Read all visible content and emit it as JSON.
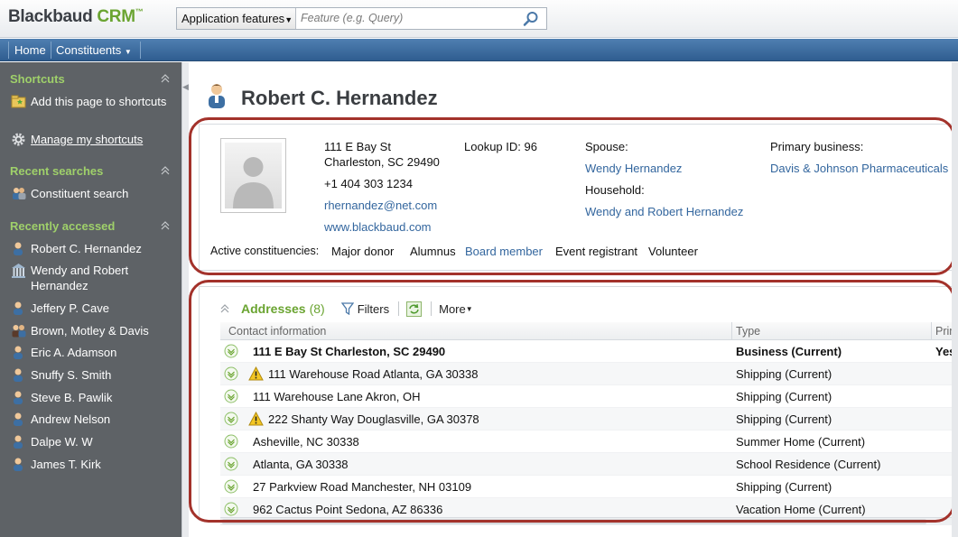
{
  "app": {
    "logo_main": "Blackbaud ",
    "logo_accent": "CRM",
    "logo_tm": "™"
  },
  "search": {
    "scope_label": "Application features",
    "placeholder": "Feature (e.g. Query)"
  },
  "nav": {
    "home": "Home",
    "constituents": "Constituents"
  },
  "sidebar": {
    "shortcuts": {
      "title": "Shortcuts",
      "items": [
        {
          "label": "Add this page to shortcuts",
          "icon": "add-shortcut-folder-icon"
        },
        {
          "label": "Manage my shortcuts",
          "icon": "gear-icon"
        }
      ]
    },
    "recent_searches": {
      "title": "Recent searches",
      "items": [
        {
          "label": "Constituent search",
          "icon": "people-search-icon"
        }
      ]
    },
    "recently_accessed": {
      "title": "Recently accessed",
      "items": [
        {
          "label": "Robert C. Hernandez",
          "icon": "person-icon"
        },
        {
          "label": "Wendy and Robert Hernandez",
          "icon": "household-icon"
        },
        {
          "label": "Jeffery P. Cave",
          "icon": "person-icon"
        },
        {
          "label": "Brown, Motley & Davis",
          "icon": "group-icon"
        },
        {
          "label": "Eric A. Adamson",
          "icon": "person-icon"
        },
        {
          "label": "Snuffy S. Smith",
          "icon": "person-icon"
        },
        {
          "label": "Steve B. Pawlik",
          "icon": "person-icon"
        },
        {
          "label": "Andrew Nelson",
          "icon": "person-icon"
        },
        {
          "label": "Dalpe W. W",
          "icon": "person-icon"
        },
        {
          "label": "James T. Kirk",
          "icon": "person-icon"
        }
      ]
    }
  },
  "page": {
    "title": "Robert C. Hernandez"
  },
  "summary": {
    "address_line1": "111 E Bay St",
    "address_line2": "Charleston, SC  29490",
    "phone": "+1 404 303 1234",
    "email": "rhernandez@net.com",
    "website": "www.blackbaud.com",
    "lookup_label": "Lookup ID:",
    "lookup_value": "96",
    "spouse_label": "Spouse:",
    "spouse_value": "Wendy Hernandez",
    "household_label": "Household:",
    "household_value": "Wendy and Robert Hernandez",
    "business_label": "Primary business:",
    "business_value": "Davis & Johnson Pharmaceuticals",
    "constituencies_label": "Active constituencies:",
    "constituencies": [
      {
        "label": "Major donor",
        "link": false
      },
      {
        "label": "Alumnus",
        "link": false
      },
      {
        "label": "Board member",
        "link": true
      },
      {
        "label": "Event registrant",
        "link": false
      },
      {
        "label": "Volunteer",
        "link": false
      }
    ]
  },
  "addresses": {
    "title": "Addresses",
    "count": "(8)",
    "filters_label": "Filters",
    "more_label": "More",
    "columns": [
      "Contact information",
      "Type",
      "Prima"
    ],
    "rows": [
      {
        "contact": "111 E Bay St Charleston, SC 29490",
        "type": "Business (Current)",
        "primary": "Yes",
        "warning": false,
        "bold": true
      },
      {
        "contact": "111 Warehouse Road Atlanta, GA 30338",
        "type": "Shipping (Current)",
        "primary": "",
        "warning": true,
        "bold": false
      },
      {
        "contact": "111 Warehouse Lane Akron, OH",
        "type": "Shipping (Current)",
        "primary": "",
        "warning": false,
        "bold": false
      },
      {
        "contact": "222 Shanty Way Douglasville, GA 30378",
        "type": "Shipping (Current)",
        "primary": "",
        "warning": true,
        "bold": false
      },
      {
        "contact": "Asheville, NC 30338",
        "type": "Summer Home (Current)",
        "primary": "",
        "warning": false,
        "bold": false
      },
      {
        "contact": "Atlanta, GA 30338",
        "type": "School Residence (Current)",
        "primary": "",
        "warning": false,
        "bold": false
      },
      {
        "contact": "27 Parkview Road Manchester, NH 03109",
        "type": "Shipping (Current)",
        "primary": "",
        "warning": false,
        "bold": false
      },
      {
        "contact": "962 Cactus Point Sedona, AZ 86336",
        "type": "Vacation Home (Current)",
        "primary": "",
        "warning": false,
        "bold": false
      }
    ]
  }
}
